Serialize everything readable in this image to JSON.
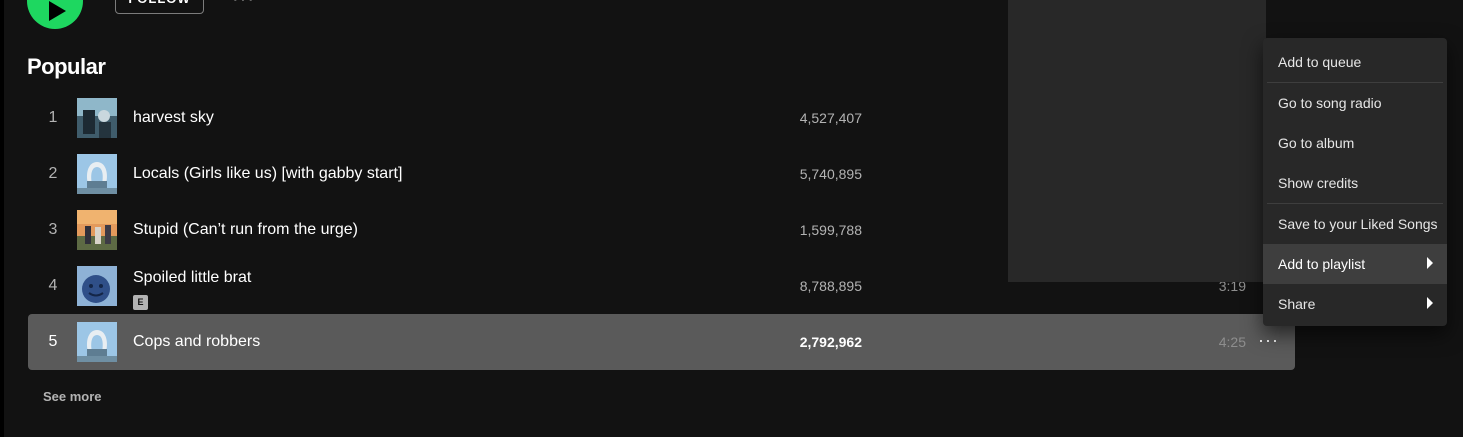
{
  "header": {
    "follow_label": "FOLLOW",
    "more_label": "···"
  },
  "popular": {
    "title": "Popular",
    "tracks": [
      {
        "number": "1",
        "title": "harvest sky",
        "plays": "4,527,407",
        "explicit": false,
        "duration": ""
      },
      {
        "number": "2",
        "title": "Locals (Girls like us) [with gabby start]",
        "plays": "5,740,895",
        "explicit": false,
        "duration": ""
      },
      {
        "number": "3",
        "title": "Stupid (Can’t run from the urge)",
        "plays": "1,599,788",
        "explicit": false,
        "duration": ""
      },
      {
        "number": "4",
        "title": "Spoiled little brat",
        "plays": "8,788,895",
        "explicit": true,
        "explicit_label": "E",
        "duration": "3:19"
      },
      {
        "number": "5",
        "title": "Cops and robbers",
        "plays": "2,792,962",
        "explicit": false,
        "duration": "4:25",
        "more_label": "···"
      }
    ],
    "see_more_label": "See more"
  },
  "context_menu": {
    "items": [
      {
        "label": "Add to queue",
        "submenu": false
      },
      {
        "label": "Go to song radio",
        "submenu": false
      },
      {
        "label": "Go to album",
        "submenu": false
      },
      {
        "label": "Show credits",
        "submenu": false
      },
      {
        "label": "Save to your Liked Songs",
        "submenu": false
      },
      {
        "label": "Add to playlist",
        "submenu": true,
        "highlighted": true
      },
      {
        "label": "Share",
        "submenu": true
      }
    ]
  },
  "colors": {
    "accent": "#1ed760",
    "background": "#121212",
    "menu_background": "#282828",
    "selected_row": "#5a5a5a"
  },
  "icons": {
    "play": "play-icon",
    "submenu": "chevron-right-icon",
    "more": "more-horizontal-icon"
  }
}
